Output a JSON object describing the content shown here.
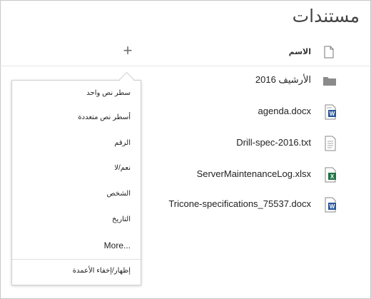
{
  "page_title": "مستندات",
  "header": {
    "add_column": "+",
    "name_column": "الاسم"
  },
  "files": [
    {
      "name": "الأرشيف 2016",
      "icon": "folder-icon"
    },
    {
      "name": "agenda.docx",
      "icon": "word-file-icon"
    },
    {
      "name": "Drill-spec-2016.txt",
      "icon": "text-file-icon"
    },
    {
      "name": "ServerMaintenanceLog.xlsx",
      "icon": "excel-file-icon"
    },
    {
      "name": "Tricone-specifications_75537.docx",
      "icon": "word-file-icon"
    }
  ],
  "column_menu": {
    "items": [
      "سطر نص واحد",
      "أسطر نص متعددة",
      "الرقم",
      "نعم/لا",
      "الشخص",
      "التاريخ",
      "More..."
    ],
    "footer": "إظهار/إخفاء الأعمدة"
  },
  "colors": {
    "word": "#2b579a",
    "excel": "#217346",
    "folder": "#8a8a8a"
  }
}
